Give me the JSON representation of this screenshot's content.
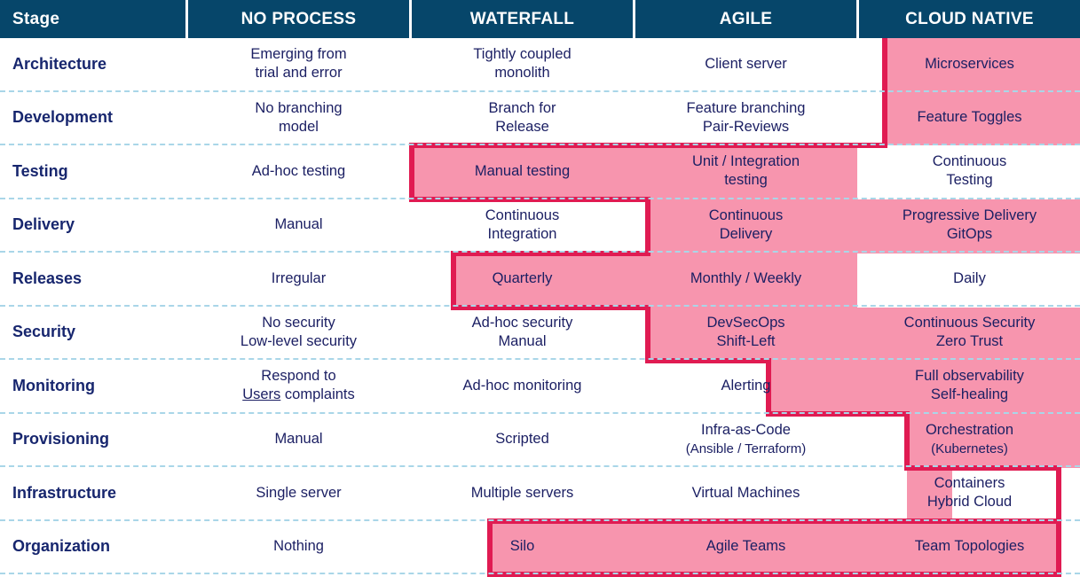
{
  "table": {
    "columns": [
      {
        "key": "stage",
        "label": "Stage"
      },
      {
        "key": "no_process",
        "label": "NO PROCESS"
      },
      {
        "key": "waterfall",
        "label": "WATERFALL"
      },
      {
        "key": "agile",
        "label": "AGILE"
      },
      {
        "key": "cloud_native",
        "label": "CLOUD NATIVE"
      }
    ],
    "rows": [
      {
        "stage": "Architecture",
        "no_process": [
          "Emerging from",
          "trial and error"
        ],
        "waterfall": [
          "Tightly coupled",
          "monolith"
        ],
        "agile": [
          "Client server"
        ],
        "cloud_native": [
          "Microservices"
        ]
      },
      {
        "stage": "Development",
        "no_process": [
          "No branching",
          "model"
        ],
        "waterfall": [
          "Branch for",
          "Release"
        ],
        "agile": [
          "Feature branching",
          "Pair-Reviews"
        ],
        "cloud_native": [
          "Feature Toggles"
        ]
      },
      {
        "stage": "Testing",
        "no_process": [
          "Ad-hoc testing"
        ],
        "waterfall": [
          "Manual testing"
        ],
        "agile": [
          "Unit / Integration",
          "testing"
        ],
        "cloud_native": [
          "Continuous",
          "Testing"
        ]
      },
      {
        "stage": "Delivery",
        "no_process": [
          "Manual"
        ],
        "waterfall": [
          "Continuous",
          "Integration"
        ],
        "agile": [
          "Continuous",
          "Delivery"
        ],
        "cloud_native": [
          "Progressive Delivery",
          "GitOps"
        ]
      },
      {
        "stage": "Releases",
        "no_process": [
          "Irregular"
        ],
        "waterfall": [
          "Quarterly"
        ],
        "agile": [
          "Monthly / Weekly"
        ],
        "cloud_native": [
          "Daily"
        ]
      },
      {
        "stage": "Security",
        "no_process": [
          "No security",
          "Low-level security"
        ],
        "waterfall": [
          "Ad-hoc security",
          "Manual"
        ],
        "agile": [
          "DevSecOps",
          "Shift-Left"
        ],
        "cloud_native": [
          "Continuous Security",
          "Zero Trust"
        ]
      },
      {
        "stage": "Monitoring",
        "no_process": [
          "Respond to",
          "Users complaints"
        ],
        "waterfall": [
          "Ad-hoc monitoring"
        ],
        "agile": [
          "Alerting"
        ],
        "cloud_native": [
          "Full observability",
          "Self-healing"
        ]
      },
      {
        "stage": "Provisioning",
        "no_process": [
          "Manual"
        ],
        "waterfall": [
          "Scripted"
        ],
        "agile": [
          "Infra-as-Code",
          "(Ansible / Terraform)"
        ],
        "cloud_native": [
          "Orchestration",
          "(Kubernetes)"
        ]
      },
      {
        "stage": "Infrastructure",
        "no_process": [
          "Single server"
        ],
        "waterfall": [
          "Multiple servers"
        ],
        "agile": [
          "Virtual Machines"
        ],
        "cloud_native": [
          "Containers",
          "Hybrid Cloud"
        ]
      },
      {
        "stage": "Organization",
        "no_process": [
          "Nothing"
        ],
        "waterfall": [
          "Silo"
        ],
        "agile": [
          "Agile Teams"
        ],
        "cloud_native": [
          "Team Topologies"
        ]
      }
    ]
  },
  "highlight": {
    "label": "devops-adoption-path",
    "fill_color": "#F795AE",
    "outline_color": "#E01B52",
    "header_color": "#06466A",
    "text_color": "#1B1F63",
    "row_divider_color": "#A9D6E8"
  }
}
